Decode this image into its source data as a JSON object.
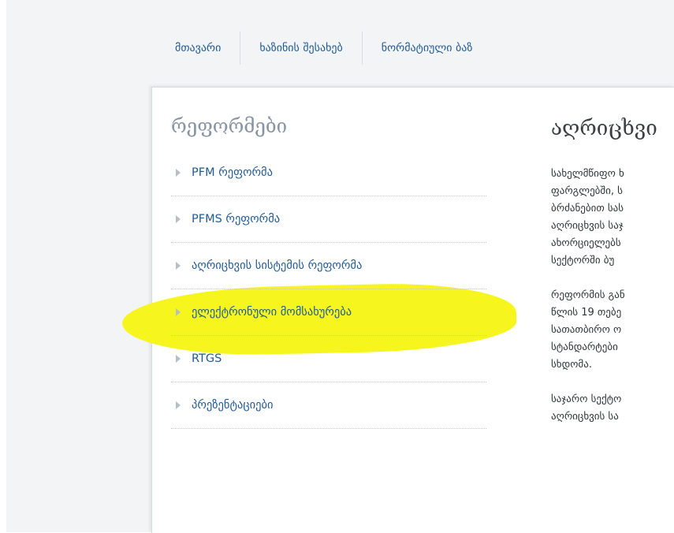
{
  "nav": {
    "items": [
      "მთავარი",
      "ხაზინის შესახებ",
      "ნორმატიული ბაზ"
    ]
  },
  "sidebar": {
    "title": "რეფორმები",
    "items": [
      {
        "label": "PFM რეფორმა",
        "highlighted": false
      },
      {
        "label": "PFMS რეფორმა",
        "highlighted": false
      },
      {
        "label": "აღრიცხვის სისტემის რეფორმა",
        "highlighted": true
      },
      {
        "label": "ელექტრონული მომსახურება",
        "highlighted": false
      },
      {
        "label": "RTGS",
        "highlighted": false
      },
      {
        "label": "პრეზენტაციები",
        "highlighted": false
      }
    ]
  },
  "article": {
    "title": "აღრიცხვი",
    "paragraphs": [
      [
        "სახელმწიფო ხ",
        "ფარგლებში, ს",
        "ბრძანებით სას",
        "აღრიცხვის საჯ",
        "ახორციელებს",
        "სექტორში ბუ"
      ],
      [
        "რეფორმის გან",
        "წლის 19 თებე",
        "სათათბირო ო",
        "სტანდარტები",
        "სხდომა."
      ],
      [
        "საჯარო სექტო",
        "აღრიცხვის სა"
      ]
    ]
  },
  "colors": {
    "link": "#1f5a97",
    "highlight": "#f6f61e",
    "sidebar_title": "#8794a3"
  }
}
